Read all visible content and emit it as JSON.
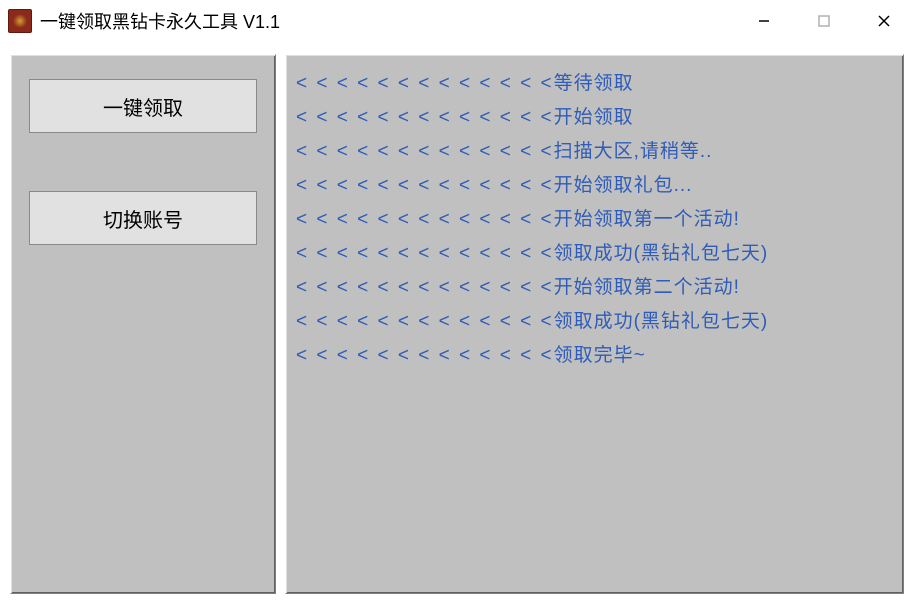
{
  "window": {
    "title": "一键领取黑钻卡永久工具 V1.1"
  },
  "buttons": {
    "claim": "一键领取",
    "switch_account": "切换账号"
  },
  "log_prefix": "< < < < < < < < < < < < <",
  "log": [
    "等待领取",
    "开始领取",
    "扫描大区,请稍等..",
    "开始领取礼包...",
    "开始领取第一个活动!",
    "领取成功(黑钻礼包七天)",
    "开始领取第二个活动!",
    "领取成功(黑钻礼包七天)",
    "领取完毕~"
  ]
}
